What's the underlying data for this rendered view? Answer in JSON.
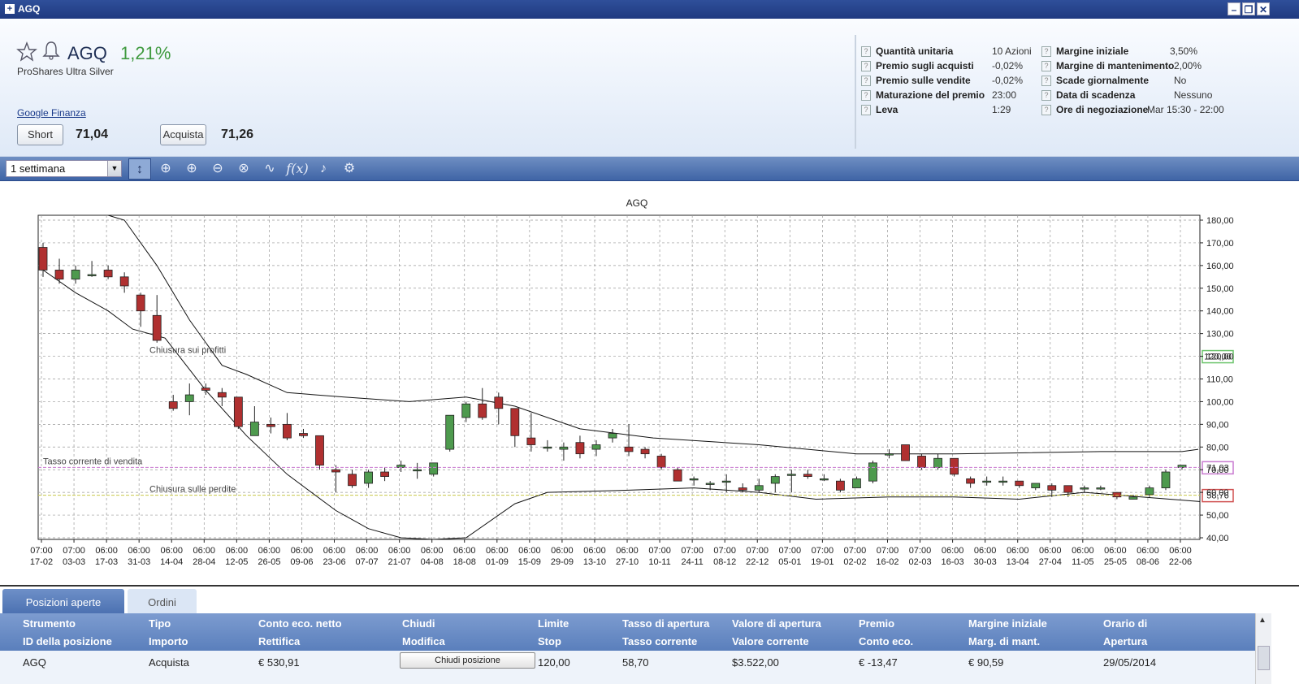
{
  "window": {
    "title": "AGQ"
  },
  "instrument": {
    "symbol": "AGQ",
    "change": "1,21%",
    "name": "ProShares Ultra Silver",
    "link": "Google Finanza"
  },
  "trade": {
    "short_label": "Short",
    "short_price": "71,04",
    "buy_label": "Acquista",
    "buy_price": "71,26"
  },
  "info": {
    "left": [
      {
        "label": "Quantità unitaria",
        "value": "10 Azioni"
      },
      {
        "label": "Premio sugli acquisti",
        "value": "-0,02%"
      },
      {
        "label": "Premio sulle vendite",
        "value": "-0,02%"
      },
      {
        "label": "Maturazione del premio",
        "value": "23:00"
      },
      {
        "label": "Leva",
        "value": "1:29"
      }
    ],
    "right": [
      {
        "label": "Margine iniziale",
        "value": "3,50%"
      },
      {
        "label": "Margine di mantenimento",
        "value": "2,00%"
      },
      {
        "label": "Scade giornalmente",
        "value": "No"
      },
      {
        "label": "Data di scadenza",
        "value": "Nessuno"
      },
      {
        "label": "Ore di negoziazione",
        "value": "Mar 15:30 - 22:00"
      }
    ]
  },
  "toolbar": {
    "period": "1 settimana",
    "tools": [
      "cursor-tool-icon",
      "crosshair-icon",
      "zoom-in-icon",
      "zoom-out-icon",
      "zoom-reset-icon",
      "line-chart-icon",
      "function-icon",
      "alert-bell-icon",
      "settings-gear-icon"
    ]
  },
  "chart_data": {
    "type": "candlestick",
    "title": "AGQ",
    "ylim": [
      40,
      180
    ],
    "yticks": [
      "180,00",
      "170,00",
      "160,00",
      "150,00",
      "140,00",
      "130,00",
      "120,00",
      "110,00",
      "100,00",
      "90,00",
      "80,00",
      "70,00",
      "60,00",
      "50,00",
      "40,00"
    ],
    "xticks": [
      [
        "07:00",
        "17-02"
      ],
      [
        "07:00",
        "03-03"
      ],
      [
        "06:00",
        "17-03"
      ],
      [
        "06:00",
        "31-03"
      ],
      [
        "06:00",
        "14-04"
      ],
      [
        "06:00",
        "28-04"
      ],
      [
        "06:00",
        "12-05"
      ],
      [
        "06:00",
        "26-05"
      ],
      [
        "06:00",
        "09-06"
      ],
      [
        "06:00",
        "23-06"
      ],
      [
        "06:00",
        "07-07"
      ],
      [
        "06:00",
        "21-07"
      ],
      [
        "06:00",
        "04-08"
      ],
      [
        "06:00",
        "18-08"
      ],
      [
        "06:00",
        "01-09"
      ],
      [
        "06:00",
        "15-09"
      ],
      [
        "06:00",
        "29-09"
      ],
      [
        "06:00",
        "13-10"
      ],
      [
        "06:00",
        "27-10"
      ],
      [
        "07:00",
        "10-11"
      ],
      [
        "07:00",
        "24-11"
      ],
      [
        "07:00",
        "08-12"
      ],
      [
        "07:00",
        "22-12"
      ],
      [
        "07:00",
        "05-01"
      ],
      [
        "07:00",
        "19-01"
      ],
      [
        "07:00",
        "02-02"
      ],
      [
        "07:00",
        "16-02"
      ],
      [
        "07:00",
        "02-03"
      ],
      [
        "06:00",
        "16-03"
      ],
      [
        "06:00",
        "30-03"
      ],
      [
        "06:00",
        "13-04"
      ],
      [
        "06:00",
        "27-04"
      ],
      [
        "06:00",
        "11-05"
      ],
      [
        "06:00",
        "25-05"
      ],
      [
        "06:00",
        "08-06"
      ],
      [
        "06:00",
        "22-06"
      ]
    ],
    "candles": [
      [
        168,
        158,
        170,
        155
      ],
      [
        158,
        154,
        163,
        152
      ],
      [
        154,
        158,
        160,
        152
      ],
      [
        156,
        156,
        162,
        155
      ],
      [
        158,
        155,
        160,
        154
      ],
      [
        155,
        151,
        157,
        148
      ],
      [
        147,
        140,
        148,
        133
      ],
      [
        138,
        127,
        147,
        126
      ],
      [
        100,
        97,
        103,
        96
      ],
      [
        100,
        103,
        108,
        94
      ],
      [
        106,
        105,
        108,
        103
      ],
      [
        104,
        102,
        106,
        98
      ],
      [
        102,
        89,
        102,
        88
      ],
      [
        85,
        91,
        98,
        85
      ],
      [
        90,
        89,
        93,
        86
      ],
      [
        90,
        84,
        95,
        83
      ],
      [
        86,
        85,
        88,
        84
      ],
      [
        85,
        72,
        85,
        70
      ],
      [
        70,
        69,
        72,
        60
      ],
      [
        68,
        63,
        70,
        62
      ],
      [
        64,
        69,
        70,
        62
      ],
      [
        69,
        67,
        71,
        65
      ],
      [
        71,
        72,
        74,
        69
      ],
      [
        70,
        70,
        73,
        66
      ],
      [
        68,
        73,
        73,
        67
      ],
      [
        79,
        94,
        94,
        78
      ],
      [
        93,
        99,
        100,
        91
      ],
      [
        99,
        93,
        106,
        92
      ],
      [
        102,
        97,
        104,
        90
      ],
      [
        97,
        85,
        97,
        80
      ],
      [
        84,
        81,
        95,
        78
      ],
      [
        80,
        80,
        83,
        78
      ],
      [
        79,
        80,
        82,
        74
      ],
      [
        82,
        77,
        85,
        75
      ],
      [
        79,
        81,
        83,
        76
      ],
      [
        84,
        86,
        88,
        82
      ],
      [
        80,
        78,
        90,
        76
      ],
      [
        79,
        77,
        80,
        75
      ],
      [
        76,
        71,
        77,
        70
      ],
      [
        70,
        65,
        71,
        65
      ],
      [
        66,
        66,
        67,
        63
      ],
      [
        64,
        64,
        65,
        61
      ],
      [
        65,
        65,
        68,
        60
      ],
      [
        62,
        61,
        64,
        60
      ],
      [
        61,
        63,
        66,
        60
      ],
      [
        64,
        67,
        68,
        60
      ],
      [
        68,
        68,
        70,
        60
      ],
      [
        68,
        67,
        70,
        66
      ],
      [
        66,
        66,
        68,
        65
      ],
      [
        65,
        61,
        66,
        60
      ],
      [
        62,
        66,
        67,
        62
      ],
      [
        65,
        73,
        74,
        64
      ],
      [
        77,
        77,
        79,
        75
      ],
      [
        81,
        74,
        81,
        74
      ],
      [
        76,
        71,
        77,
        70
      ],
      [
        71,
        75,
        77,
        70
      ],
      [
        75,
        68,
        75,
        67
      ],
      [
        66,
        64,
        67,
        62
      ],
      [
        65,
        65,
        67,
        63
      ],
      [
        65,
        65,
        67,
        63
      ],
      [
        65,
        63,
        65,
        62
      ],
      [
        62,
        64,
        64,
        61
      ],
      [
        63,
        61,
        64,
        58
      ],
      [
        63,
        60,
        63,
        58
      ],
      [
        62,
        62,
        63,
        60
      ],
      [
        62,
        62,
        63,
        61
      ],
      [
        60,
        58,
        60,
        57
      ],
      [
        57,
        58,
        59,
        57
      ],
      [
        59,
        62,
        63,
        58
      ],
      [
        62,
        69,
        70,
        61
      ],
      [
        71,
        72,
        72,
        70
      ]
    ],
    "upper_band": [
      [
        8,
        195
      ],
      [
        10,
        180
      ],
      [
        14,
        160
      ],
      [
        18,
        136
      ],
      [
        22,
        116
      ],
      [
        25,
        112
      ],
      [
        30,
        104
      ],
      [
        37,
        102
      ],
      [
        45,
        100
      ],
      [
        52,
        102
      ],
      [
        58,
        98
      ],
      [
        66,
        88
      ],
      [
        75,
        84
      ],
      [
        88,
        81
      ],
      [
        100,
        77
      ],
      [
        112,
        77
      ],
      [
        130,
        78
      ],
      [
        140,
        78
      ],
      [
        142,
        79
      ]
    ],
    "lower_band": [
      [
        0,
        158
      ],
      [
        4,
        148
      ],
      [
        8,
        140
      ],
      [
        11,
        132
      ],
      [
        15,
        128
      ],
      [
        20,
        105
      ],
      [
        25,
        85
      ],
      [
        30,
        68
      ],
      [
        36,
        52
      ],
      [
        40,
        44
      ],
      [
        44,
        40
      ],
      [
        48,
        38
      ],
      [
        52,
        40
      ],
      [
        58,
        55
      ],
      [
        62,
        60
      ],
      [
        72,
        61
      ],
      [
        80,
        62
      ],
      [
        88,
        60
      ],
      [
        95,
        57
      ],
      [
        104,
        58
      ],
      [
        112,
        58
      ],
      [
        120,
        57
      ],
      [
        128,
        60
      ],
      [
        135,
        58
      ],
      [
        142,
        56
      ],
      [
        146,
        55
      ],
      [
        150,
        54
      ],
      [
        156,
        52
      ],
      [
        160,
        53
      ],
      [
        162,
        52
      ]
    ],
    "annotations": [
      {
        "text": "Chiusura sui profitti",
        "y": 120
      },
      {
        "text": "Tasso corrente di vendita",
        "y": 71.03
      },
      {
        "text": "Chiusura sulle perdite",
        "y": 58.76
      }
    ],
    "price_tags": [
      {
        "value": "120,00",
        "y": 120,
        "color": "#6cc46c"
      },
      {
        "value": "71,03",
        "y": 71.03,
        "color": "#c97ad0"
      },
      {
        "value": "58,76",
        "y": 58.76,
        "color": "#d05050"
      }
    ],
    "colors": {
      "up": "#4e9a4e",
      "down": "#b03030",
      "grid": "#999999"
    }
  },
  "tabs": [
    {
      "label": "Posizioni aperte"
    },
    {
      "label": "Ordini"
    }
  ],
  "table": {
    "head1": [
      "Strumento",
      "Tipo",
      "Conto eco. netto",
      "Chiudi",
      "Limite",
      "Tasso di apertura",
      "Valore di apertura",
      "Premio",
      "Margine iniziale",
      "Orario di"
    ],
    "head2": [
      "ID della posizione",
      "Importo",
      "Rettifica",
      "Modifica",
      "Stop",
      "Tasso corrente",
      "Valore corrente",
      "Conto eco.",
      "Marg. di mant.",
      "Apertura"
    ],
    "row": [
      "AGQ",
      "Acquista",
      "€ 530,91",
      "",
      "120,00",
      "58,70",
      "$3.522,00",
      "€ -13,47",
      "€ 90,59",
      "29/05/2014"
    ],
    "close_label": "Chiudi posizione"
  }
}
